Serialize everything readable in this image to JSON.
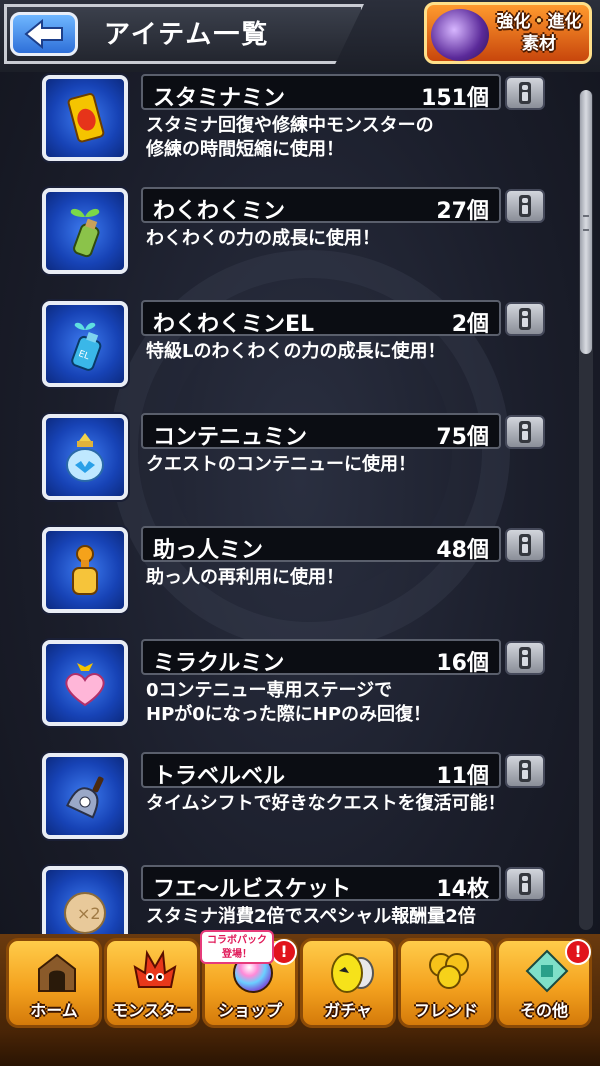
{
  "header": {
    "title": "アイテム一覧",
    "back_icon": "back-arrow-icon",
    "evolve_button": {
      "line1": "強化",
      "line2": "進化",
      "line3": "素材"
    }
  },
  "items": [
    {
      "name": "スタミナミン",
      "count": "151個",
      "desc": [
        "スタミナ回復や修練中モンスターの",
        "修練の時間短縮に使用！"
      ],
      "icon": "can-icon"
    },
    {
      "name": "わくわくミン",
      "count": "27個",
      "desc": [
        "わくわくの力の成長に使用！"
      ],
      "icon": "sprout-bottle-icon"
    },
    {
      "name": "わくわくミンEL",
      "count": "2個",
      "desc": [
        "特級Lのわくわくの力の成長に使用！"
      ],
      "icon": "el-bottle-icon"
    },
    {
      "name": "コンテニュミン",
      "count": "75個",
      "desc": [
        "クエストのコンテニューに使用！"
      ],
      "icon": "jar-icon"
    },
    {
      "name": "助っ人ミン",
      "count": "48個",
      "desc": [
        "助っ人の再利用に使用！"
      ],
      "icon": "helper-bottle-icon"
    },
    {
      "name": "ミラクルミン",
      "count": "16個",
      "desc": [
        "0コンテニュー専用ステージで",
        "HPが0になった際にHPのみ回復！"
      ],
      "icon": "heart-bottle-icon"
    },
    {
      "name": "トラベルベル",
      "count": "11個",
      "desc": [
        "タイムシフトで好きなクエストを復活可能！"
      ],
      "icon": "bell-icon"
    },
    {
      "name": "フエ〜ルビスケット",
      "count": "14枚",
      "desc": [
        "スタミナ消費2倍でスペシャル報酬量2倍"
      ],
      "icon": "biscuit-icon"
    }
  ],
  "bottom_nav": [
    {
      "label": "ホーム",
      "icon": "home-icon"
    },
    {
      "label": "モンスター",
      "icon": "monster-icon"
    },
    {
      "label": "ショップ",
      "icon": "shop-orb-icon",
      "badge": "!"
    },
    {
      "label": "ガチャ",
      "icon": "gacha-egg-icon"
    },
    {
      "label": "フレンド",
      "icon": "friend-balloons-icon"
    },
    {
      "label": "その他",
      "icon": "other-icon",
      "badge": "!"
    }
  ],
  "collab_badge": {
    "line1": "コラボパック",
    "line2": "登場！"
  }
}
